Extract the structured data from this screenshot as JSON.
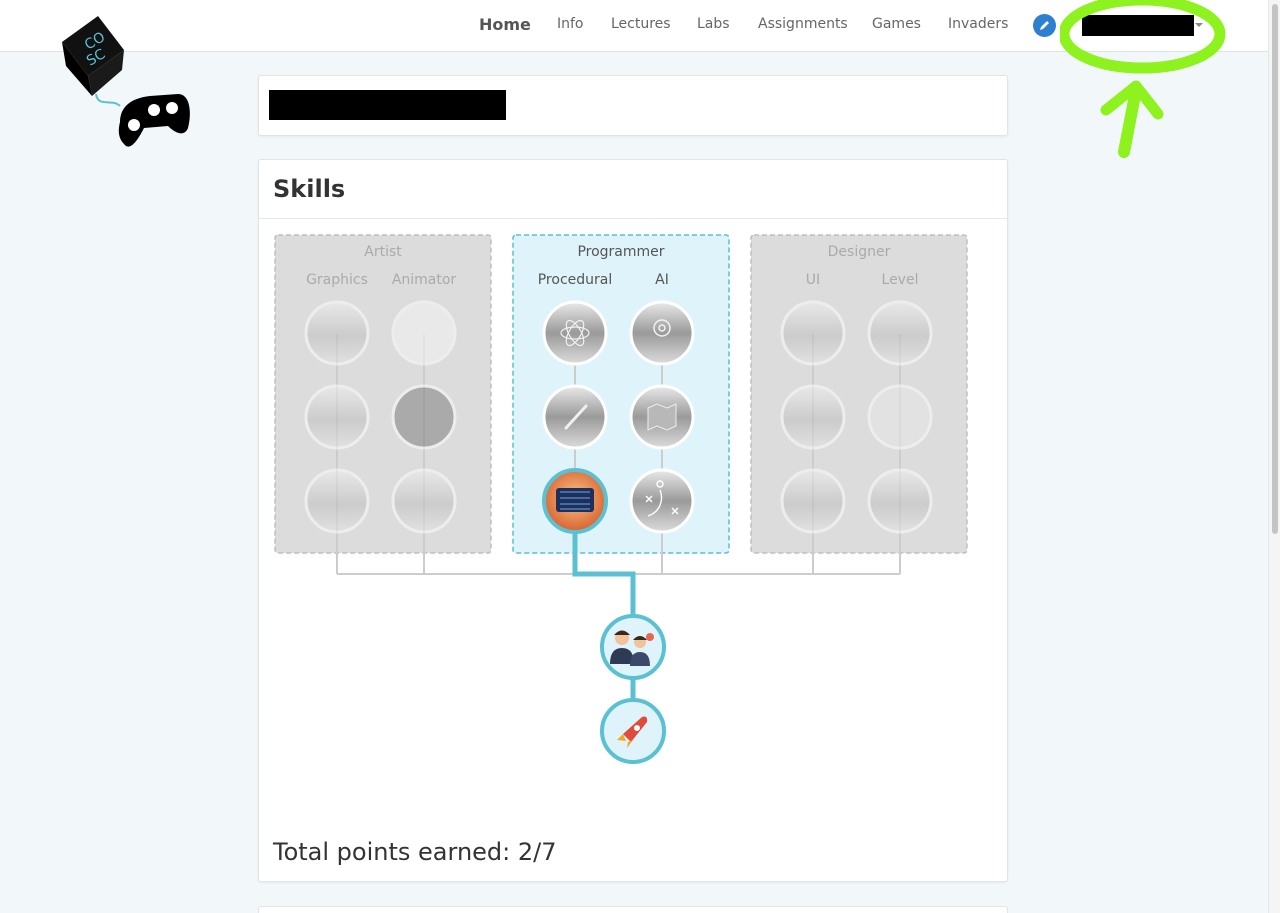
{
  "nav": {
    "items": [
      "Home",
      "Info",
      "Lectures",
      "Labs",
      "Assignments",
      "Games",
      "Invaders"
    ],
    "active": "Home",
    "edit_icon": "pencil-icon"
  },
  "skills": {
    "heading": "Skills",
    "tracks": [
      {
        "name": "Artist",
        "state": "locked",
        "subtracks": [
          "Graphics",
          "Animator"
        ]
      },
      {
        "name": "Programmer",
        "state": "active",
        "subtracks": [
          "Procedural",
          "AI"
        ]
      },
      {
        "name": "Designer",
        "state": "locked",
        "subtracks": [
          "UI",
          "Level"
        ]
      }
    ],
    "total_label": "Total points earned: 2/7",
    "points_earned": 2,
    "points_total": 7
  },
  "colors": {
    "accent": "#5ac0d2",
    "active_track_bg": "#dff3fb",
    "locked_track_bg": "#dcdcdc",
    "highlight": "#8ef21e",
    "edit_button": "#2f7fd0"
  }
}
